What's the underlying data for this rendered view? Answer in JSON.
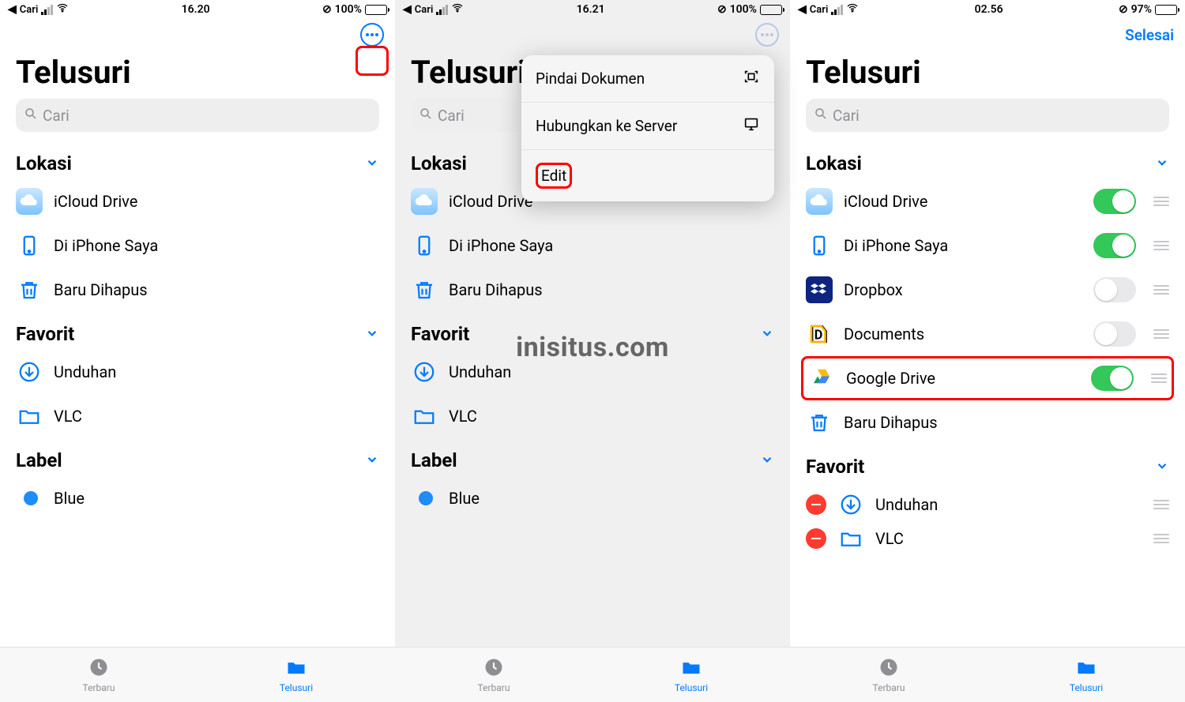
{
  "watermark": "inisitus.com",
  "common": {
    "back_app": "Cari",
    "title": "Telusuri",
    "search_placeholder": "Cari",
    "section_locations": "Lokasi",
    "section_favorites": "Favorit",
    "section_labels": "Label",
    "tab_recents": "Terbaru",
    "tab_browse": "Telusuri"
  },
  "screens": [
    {
      "id": "s1",
      "time": "16.20",
      "battery_pct": "100%",
      "battery_fill": 100,
      "locations": [
        {
          "icon": "icloud",
          "label": "iCloud Drive"
        },
        {
          "icon": "iphone",
          "label": "Di iPhone Saya"
        },
        {
          "icon": "trash",
          "label": "Baru Dihapus"
        }
      ],
      "favorites": [
        {
          "icon": "download",
          "label": "Unduhan"
        },
        {
          "icon": "folder",
          "label": "VLC"
        }
      ],
      "labels": [
        {
          "color": "#1e8bff",
          "label": "Blue"
        }
      ]
    },
    {
      "id": "s2",
      "time": "16.21",
      "battery_pct": "100%",
      "battery_fill": 100,
      "menu": [
        {
          "label": "Pindai Dokumen",
          "icon": "scan"
        },
        {
          "label": "Hubungkan ke Server",
          "icon": "server"
        },
        {
          "label": "Edit",
          "icon": "",
          "highlight": true
        }
      ],
      "locations": [
        {
          "icon": "icloud",
          "label": "iCloud Drive"
        },
        {
          "icon": "iphone",
          "label": "Di iPhone Saya"
        },
        {
          "icon": "trash",
          "label": "Baru Dihapus"
        }
      ],
      "favorites": [
        {
          "icon": "download",
          "label": "Unduhan"
        },
        {
          "icon": "folder",
          "label": "VLC"
        }
      ],
      "labels": [
        {
          "color": "#1e8bff",
          "label": "Blue"
        }
      ]
    },
    {
      "id": "s3",
      "time": "02.56",
      "battery_pct": "97%",
      "battery_fill": 97,
      "done_label": "Selesai",
      "locations_edit": [
        {
          "icon": "icloud",
          "label": "iCloud Drive",
          "on": true,
          "drag": true
        },
        {
          "icon": "iphone",
          "label": "Di iPhone Saya",
          "on": true,
          "drag": true
        },
        {
          "icon": "dropbox",
          "label": "Dropbox",
          "on": false,
          "drag": true
        },
        {
          "icon": "documents",
          "label": "Documents",
          "on": false,
          "drag": true
        },
        {
          "icon": "gdrive",
          "label": "Google Drive",
          "on": true,
          "drag": true,
          "highlight": true
        },
        {
          "icon": "trash",
          "label": "Baru Dihapus",
          "on": null,
          "drag": false
        }
      ],
      "favorites_edit": [
        {
          "icon": "download",
          "label": "Unduhan",
          "remove": true,
          "drag": true
        },
        {
          "icon": "folder",
          "label": "VLC",
          "remove": true,
          "drag": true
        }
      ]
    }
  ]
}
